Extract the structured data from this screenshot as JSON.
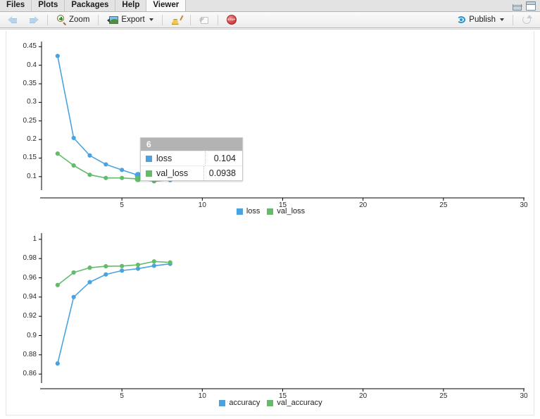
{
  "window": {
    "minimize_icon": "minimize-icon",
    "maximize_icon": "maximize-icon"
  },
  "tabs": [
    {
      "label": "Files",
      "active": false
    },
    {
      "label": "Plots",
      "active": false
    },
    {
      "label": "Packages",
      "active": false
    },
    {
      "label": "Help",
      "active": false
    },
    {
      "label": "Viewer",
      "active": true
    }
  ],
  "toolbar": {
    "back_icon": "back-arrow-icon",
    "forward_icon": "forward-arrow-icon",
    "zoom_label": "Zoom",
    "zoom_icon": "magnifier-icon",
    "export_label": "Export",
    "export_icon": "export-image-icon",
    "clear_icon": "broom-icon",
    "popout_icon": "popout-icon",
    "stop_icon": "stop-icon",
    "publish_label": "Publish",
    "publish_icon": "publish-icon",
    "refresh_icon": "refresh-icon"
  },
  "colors": {
    "series_blue": "#4aa3e0",
    "series_green": "#63bb6b",
    "tooltip_header": "#b3b3b3",
    "axis": "#000000"
  },
  "tooltip": {
    "header": "6",
    "rows": [
      {
        "name": "loss",
        "value": "0.104",
        "color": "#4aa3e0"
      },
      {
        "name": "val_loss",
        "value": "0.0938",
        "color": "#63bb6b"
      }
    ]
  },
  "chart_data": [
    {
      "type": "line",
      "title": "",
      "xlabel": "",
      "ylabel": "",
      "x": [
        1,
        2,
        3,
        4,
        5,
        6,
        7,
        8
      ],
      "xlim": [
        0,
        30
      ],
      "ylim": [
        0.075,
        0.46
      ],
      "xticks": [
        5,
        10,
        15,
        20,
        25,
        30
      ],
      "yticks": [
        0.1,
        0.15,
        0.2,
        0.25,
        0.3,
        0.35,
        0.4,
        0.45
      ],
      "ytick_labels": [
        "0.1",
        "0.15",
        "0.2",
        "0.25",
        "0.3",
        "0.35",
        "0.4",
        "0.45"
      ],
      "xtick_labels": [
        "5",
        "10",
        "15",
        "20",
        "25",
        "30"
      ],
      "grid": false,
      "legend_position": "bottom",
      "highlight_x": 6,
      "series": [
        {
          "name": "loss",
          "color": "#4aa3e0",
          "values": [
            0.425,
            0.204,
            0.157,
            0.133,
            0.118,
            0.104,
            0.0985,
            0.0905
          ]
        },
        {
          "name": "val_loss",
          "color": "#63bb6b",
          "values": [
            0.162,
            0.13,
            0.105,
            0.0965,
            0.0965,
            0.0938,
            0.0875,
            0.0915
          ]
        }
      ]
    },
    {
      "type": "line",
      "title": "",
      "xlabel": "",
      "ylabel": "",
      "x": [
        1,
        2,
        3,
        4,
        5,
        6,
        7,
        8
      ],
      "xlim": [
        0,
        30
      ],
      "ylim": [
        0.855,
        1.005
      ],
      "xticks": [
        5,
        10,
        15,
        20,
        25,
        30
      ],
      "yticks": [
        0.86,
        0.88,
        0.9,
        0.92,
        0.94,
        0.96,
        0.98,
        1
      ],
      "ytick_labels": [
        "0.86",
        "0.88",
        "0.9",
        "0.92",
        "0.94",
        "0.96",
        "0.98",
        "1"
      ],
      "xtick_labels": [
        "5",
        "10",
        "15",
        "20",
        "25",
        "30"
      ],
      "grid": false,
      "legend_position": "bottom",
      "series": [
        {
          "name": "accuracy",
          "color": "#4aa3e0",
          "values": [
            0.871,
            0.94,
            0.9555,
            0.9635,
            0.9675,
            0.9695,
            0.9725,
            0.9745
          ]
        },
        {
          "name": "val_accuracy",
          "color": "#63bb6b",
          "values": [
            0.9525,
            0.9655,
            0.9705,
            0.972,
            0.9722,
            0.9735,
            0.977,
            0.976
          ]
        }
      ]
    }
  ]
}
